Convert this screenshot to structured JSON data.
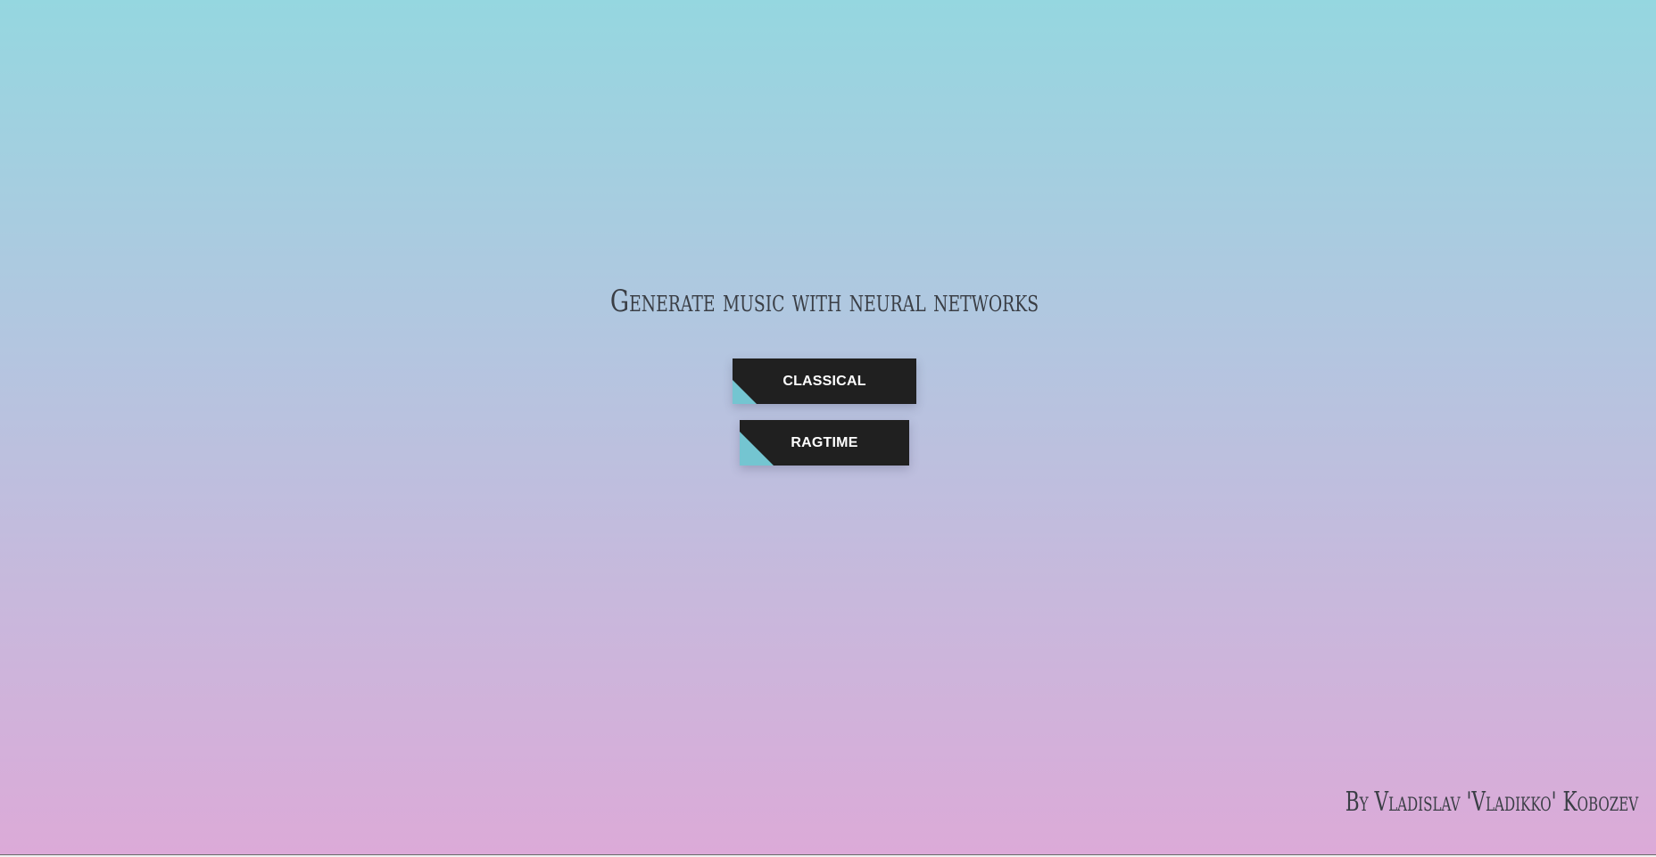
{
  "header": {
    "title": "Generate music with neural networks"
  },
  "buttons": {
    "classical_label": "CLASSICAL",
    "ragtime_label": "RAGTIME"
  },
  "footer": {
    "author": "By Vladislav 'Vladikko' Kobozev"
  },
  "colors": {
    "gradient_top": "#95d7e0",
    "gradient_bottom": "#dcaad8",
    "button_bg": "#202020",
    "button_text": "#ffffff",
    "button_accent": "#74c5d1",
    "text_dark": "#3a3e45"
  }
}
